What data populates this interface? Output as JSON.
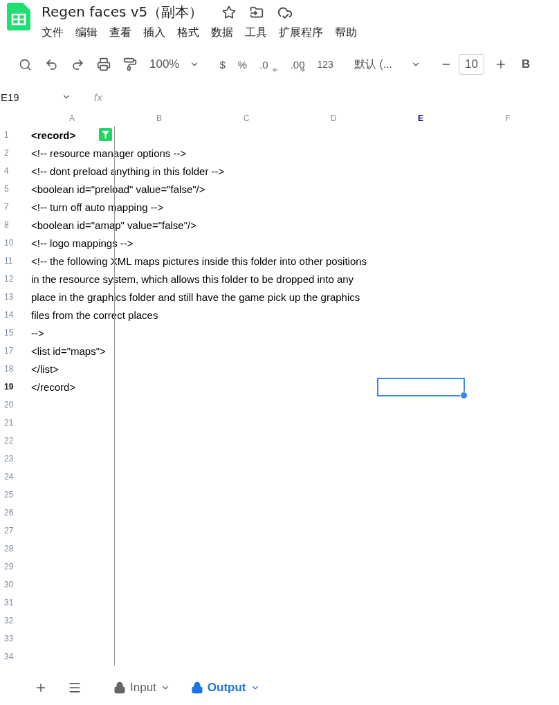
{
  "title": "Regen faces v5（副本）",
  "menu": [
    "文件",
    "编辑",
    "查看",
    "插入",
    "格式",
    "数据",
    "工具",
    "扩展程序",
    "帮助"
  ],
  "toolbar": {
    "zoom": "100%",
    "currency": "$",
    "percent": "%",
    "decrease_decimal": ".0",
    "increase_decimal": ".00",
    "number_format": "123",
    "font": "默认 (...",
    "font_size": "10",
    "bold": "B"
  },
  "name_box": "E19",
  "formula_hint": "fx",
  "columns": [
    {
      "label": "A",
      "selected": false
    },
    {
      "label": "B",
      "selected": false
    },
    {
      "label": "C",
      "selected": false
    },
    {
      "label": "D",
      "selected": false
    },
    {
      "label": "E",
      "selected": true
    },
    {
      "label": "F",
      "selected": false
    }
  ],
  "rows": [
    {
      "number": "1",
      "text": "<record>",
      "bold": true,
      "filter": true,
      "selected": false
    },
    {
      "number": "2",
      "text": "<!-- resource manager options -->",
      "selected": false
    },
    {
      "number": "4",
      "text": "<!-- dont preload anything in this folder -->",
      "selected": false
    },
    {
      "number": "5",
      "text": "<boolean id=\"preload\" value=\"false\"/>",
      "selected": false
    },
    {
      "number": "7",
      "text": "<!-- turn off auto mapping -->",
      "selected": false
    },
    {
      "number": "8",
      "text": "<boolean id=\"amap\" value=\"false\"/>",
      "selected": false
    },
    {
      "number": "10",
      "text": "<!-- logo mappings -->",
      "selected": false
    },
    {
      "number": "11",
      "text": "<!-- the following XML maps pictures inside this folder into other positions",
      "selected": false
    },
    {
      "number": "12",
      "text": "in the resource system, which allows this folder to be dropped into any",
      "selected": false
    },
    {
      "number": "13",
      "text": "place in the graphics folder and still have the game pick up the graphics",
      "selected": false
    },
    {
      "number": "14",
      "text": "files from the correct places",
      "selected": false
    },
    {
      "number": "15",
      "text": "-->",
      "selected": false
    },
    {
      "number": "17",
      "text": "<list id=\"maps\">",
      "selected": false
    },
    {
      "number": "18",
      "text": "</list>",
      "selected": false
    },
    {
      "number": "19",
      "text": "</record>",
      "selected": true
    },
    {
      "number": "20",
      "selected": false
    },
    {
      "number": "21",
      "selected": false
    },
    {
      "number": "22",
      "selected": false
    },
    {
      "number": "23",
      "selected": false
    },
    {
      "number": "24",
      "selected": false
    },
    {
      "number": "25",
      "selected": false
    },
    {
      "number": "26",
      "selected": false
    },
    {
      "number": "27",
      "selected": false
    },
    {
      "number": "28",
      "selected": false
    },
    {
      "number": "29",
      "selected": false
    },
    {
      "number": "30",
      "selected": false
    },
    {
      "number": "31",
      "selected": false
    },
    {
      "number": "32",
      "selected": false
    },
    {
      "number": "33",
      "selected": false
    },
    {
      "number": "34",
      "selected": false
    }
  ],
  "sheets": [
    {
      "label": "Input",
      "selected": false
    },
    {
      "label": "Output",
      "selected": true
    }
  ]
}
